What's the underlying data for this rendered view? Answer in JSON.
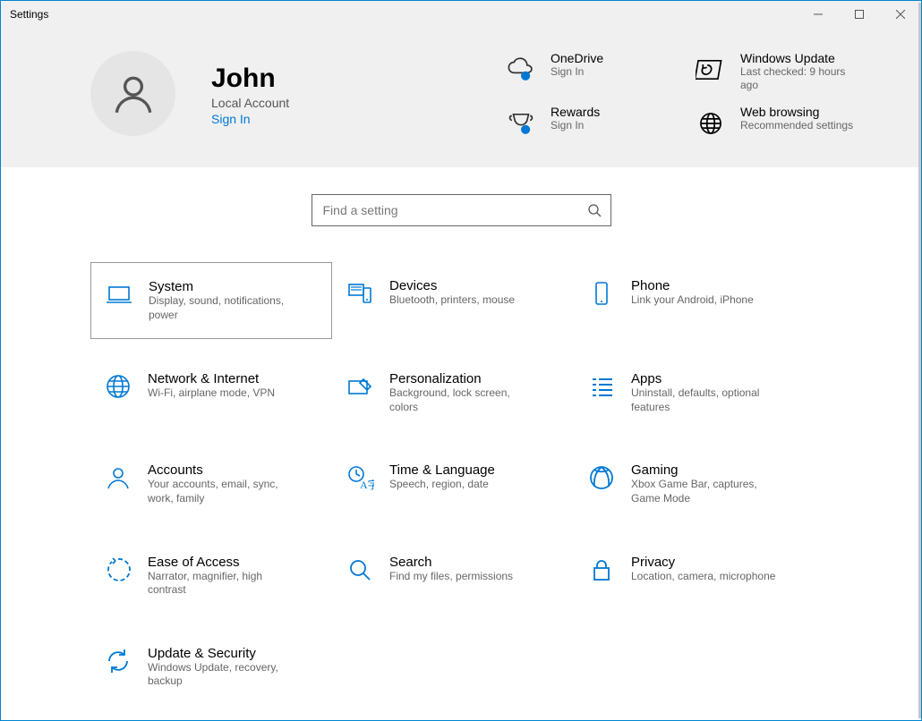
{
  "window": {
    "title": "Settings"
  },
  "user": {
    "name": "John",
    "type": "Local Account",
    "signin": "Sign In"
  },
  "tiles": [
    {
      "title": "OneDrive",
      "sub": "Sign In"
    },
    {
      "title": "Windows Update",
      "sub": "Last checked: 9 hours ago"
    },
    {
      "title": "Rewards",
      "sub": "Sign In"
    },
    {
      "title": "Web browsing",
      "sub": "Recommended settings"
    }
  ],
  "search": {
    "placeholder": "Find a setting"
  },
  "categories": [
    {
      "title": "System",
      "sub": "Display, sound, notifications, power",
      "selected": true
    },
    {
      "title": "Devices",
      "sub": "Bluetooth, printers, mouse"
    },
    {
      "title": "Phone",
      "sub": "Link your Android, iPhone"
    },
    {
      "title": "Network & Internet",
      "sub": "Wi-Fi, airplane mode, VPN"
    },
    {
      "title": "Personalization",
      "sub": "Background, lock screen, colors"
    },
    {
      "title": "Apps",
      "sub": "Uninstall, defaults, optional features"
    },
    {
      "title": "Accounts",
      "sub": "Your accounts, email, sync, work, family"
    },
    {
      "title": "Time & Language",
      "sub": "Speech, region, date"
    },
    {
      "title": "Gaming",
      "sub": "Xbox Game Bar, captures, Game Mode"
    },
    {
      "title": "Ease of Access",
      "sub": "Narrator, magnifier, high contrast"
    },
    {
      "title": "Search",
      "sub": "Find my files, permissions"
    },
    {
      "title": "Privacy",
      "sub": "Location, camera, microphone"
    },
    {
      "title": "Update & Security",
      "sub": "Windows Update, recovery, backup"
    }
  ]
}
